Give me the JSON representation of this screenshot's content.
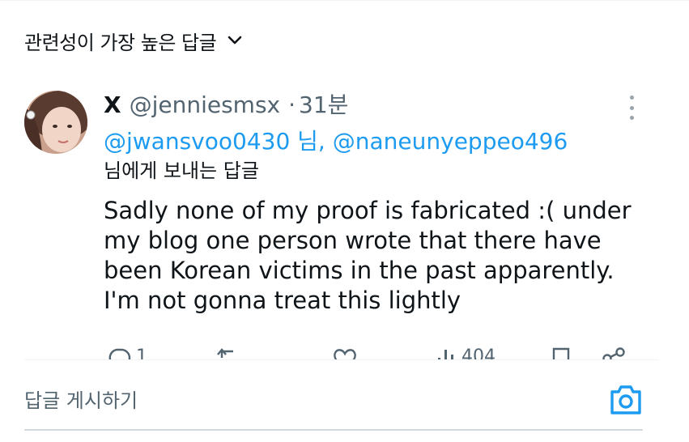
{
  "sort": {
    "label": "관련성이 가장 높은 답글"
  },
  "tweet": {
    "display_name": "X",
    "handle": "@jenniesmsx",
    "separator": "·",
    "time": "31분",
    "reply_mentions": [
      "@jwansvoo0430",
      "@naneunyeppeo496"
    ],
    "reply_mention_sep": "님,",
    "reply_suffix": "님에게 보내는 답글",
    "text": "Sadly none of my proof is fabricated :( under\nmy blog one person wrote that there have\nbeen Korean victims in the past apparently.\nI'm not gonna treat this lightly",
    "actions": {
      "reply_count": "1",
      "repost_count": "",
      "like_count": "",
      "view_count": "404"
    }
  },
  "compose": {
    "placeholder": "답글 게시하기"
  },
  "colors": {
    "accent": "#1d9bf0",
    "text": "#0f1419",
    "muted": "#536471"
  },
  "icons": [
    "chevron-down-icon",
    "more-icon",
    "reply-icon",
    "repost-icon",
    "like-icon",
    "views-icon",
    "bookmark-icon",
    "share-icon",
    "camera-icon"
  ]
}
